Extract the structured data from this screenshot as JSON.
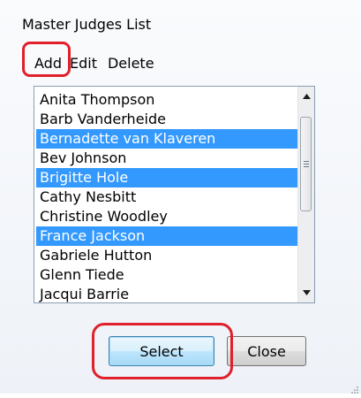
{
  "window": {
    "title": "Master Judges List"
  },
  "menu": {
    "add": "Add",
    "edit": "Edit",
    "delete": "Delete"
  },
  "list": {
    "items": [
      {
        "label": "Anita Thompson",
        "selected": false
      },
      {
        "label": "Barb Vanderheide",
        "selected": false
      },
      {
        "label": "Bernadette van Klaveren",
        "selected": true
      },
      {
        "label": "Bev Johnson",
        "selected": false
      },
      {
        "label": "Brigitte Hole",
        "selected": true
      },
      {
        "label": "Cathy Nesbitt",
        "selected": false
      },
      {
        "label": "Christine Woodley",
        "selected": false
      },
      {
        "label": "France Jackson",
        "selected": true
      },
      {
        "label": "Gabriele Hutton",
        "selected": false
      },
      {
        "label": "Glenn Tiede",
        "selected": false
      },
      {
        "label": "Jacqui Barrie",
        "selected": false
      }
    ]
  },
  "buttons": {
    "select": "Select",
    "close": "Close"
  },
  "icons": {
    "scroll_up": "scroll-up-arrow-icon",
    "scroll_down": "scroll-down-arrow-icon",
    "resize": "resize-grip-icon"
  },
  "colors": {
    "selection": "#3399ff",
    "annotation": "#e0202a"
  }
}
